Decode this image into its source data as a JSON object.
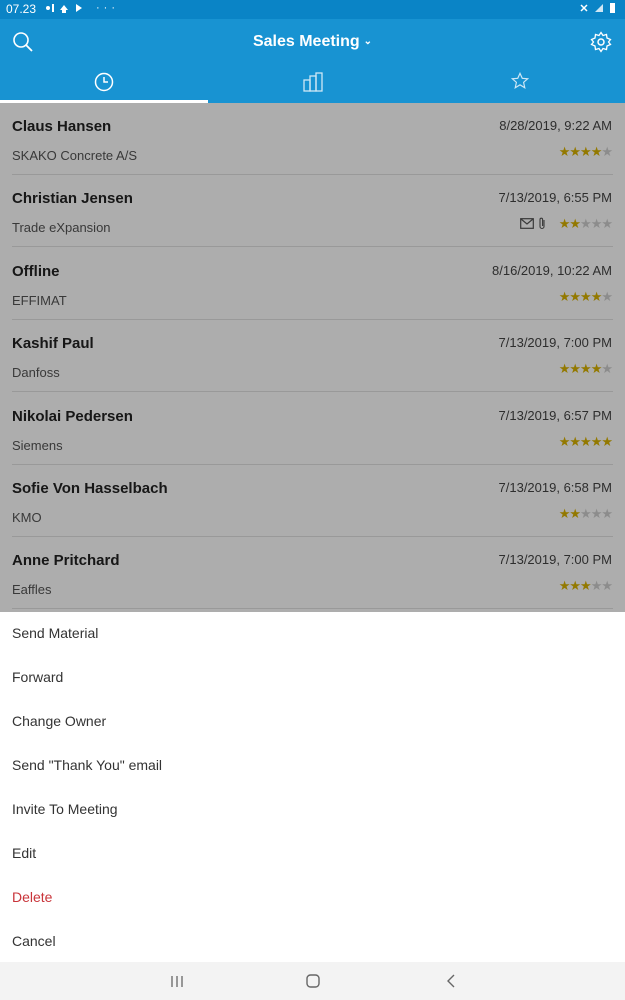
{
  "status_bar": {
    "time": "07.23",
    "notification_icons": "notification-icons",
    "dots": "···"
  },
  "header": {
    "title": "Sales Meeting"
  },
  "tabs": [
    {
      "icon": "clock-icon"
    },
    {
      "icon": "buildings-icon"
    },
    {
      "icon": "star-icon"
    }
  ],
  "contacts": [
    {
      "name": "Claus Hansen",
      "company": "SKAKO Concrete A/S",
      "date": "8/28/2019, 9:22 AM",
      "rating": 4
    },
    {
      "name": "Christian Jensen",
      "company": "Trade eXpansion",
      "date": "7/13/2019, 6:55 PM",
      "rating": 2,
      "has_mail": true,
      "has_attachment": true
    },
    {
      "name": "Offline",
      "company": "EFFIMAT",
      "date": "8/16/2019, 10:22 AM",
      "rating": 4
    },
    {
      "name": "Kashif Paul",
      "company": "Danfoss",
      "date": "7/13/2019, 7:00 PM",
      "rating": 4
    },
    {
      "name": "Nikolai Pedersen",
      "company": "Siemens",
      "date": "7/13/2019, 6:57 PM",
      "rating": 5
    },
    {
      "name": "Sofie Von Hasselbach",
      "company": "KMO",
      "date": "7/13/2019, 6:58 PM",
      "rating": 2
    },
    {
      "name": "Anne Pritchard",
      "company": "Eaffles",
      "date": "7/13/2019, 7:00 PM",
      "rating": 3
    }
  ],
  "rating_max": 5,
  "menu": {
    "send_material": "Send Material",
    "forward": "Forward",
    "change_owner": "Change Owner",
    "send_thank_you": "Send \"Thank You\" email",
    "invite": "Invite To Meeting",
    "edit": "Edit",
    "delete": "Delete",
    "cancel": "Cancel"
  },
  "colors": {
    "primary": "#1893d2",
    "status_bar": "#0a84c6",
    "star": "#d9b300",
    "danger": "#c9343a"
  }
}
